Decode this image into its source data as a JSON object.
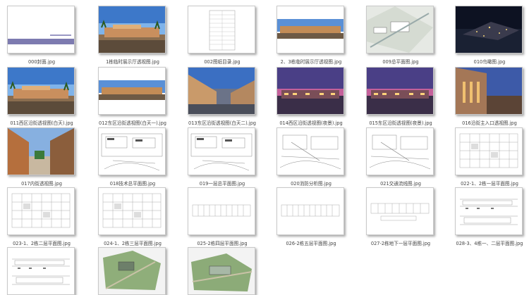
{
  "files": [
    {
      "name": "000封面.jpg",
      "kind": "cover"
    },
    {
      "name": "1栋临时展示厅透视图.jpg",
      "kind": "day"
    },
    {
      "name": "002图纸目录.jpg",
      "kind": "list"
    },
    {
      "name": "2、3栋临时展示厅透视图.jpg",
      "kind": "day2"
    },
    {
      "name": "009总平面图.jpg",
      "kind": "site"
    },
    {
      "name": "010鸟瞰图.jpg",
      "kind": "aerial"
    },
    {
      "name": "011西区沿街透视图(白天).jpg",
      "kind": "day"
    },
    {
      "name": "012东区沿街透视图(白天一).jpg",
      "kind": "day2"
    },
    {
      "name": "013东区沿街透视图(白天二).jpg",
      "kind": "street"
    },
    {
      "name": "014西区沿街透视图(夜景).jpg",
      "kind": "dusk"
    },
    {
      "name": "015东区沿街透视图(夜景).jpg",
      "kind": "dusk"
    },
    {
      "name": "016沿街主入口透视图.jpg",
      "kind": "tower"
    },
    {
      "name": "017内街透视图.jpg",
      "kind": "inner"
    },
    {
      "name": "018技术总平面图.jpg",
      "kind": "plan"
    },
    {
      "name": "019一层总平面图.jpg",
      "kind": "plan"
    },
    {
      "name": "020消防分析图.jpg",
      "kind": "plan2"
    },
    {
      "name": "021交通流线图.jpg",
      "kind": "plan2"
    },
    {
      "name": "022-1、2栋一层平面图.jpg",
      "kind": "floor"
    },
    {
      "name": "023-1、2栋二层平面图.jpg",
      "kind": "floor"
    },
    {
      "name": "024-1、2栋三层平面图.jpg",
      "kind": "floor"
    },
    {
      "name": "025-2栋四层平面图.jpg",
      "kind": "long"
    },
    {
      "name": "026-2栋五层平面图.jpg",
      "kind": "long"
    },
    {
      "name": "027-2栋地下一层平面图.jpg",
      "kind": "long2"
    },
    {
      "name": "028-3、4栋一、二层平面图.jpg",
      "kind": "elev"
    },
    {
      "name": "",
      "kind": "elev"
    },
    {
      "name": "",
      "kind": "green"
    },
    {
      "name": "",
      "kind": "green2"
    }
  ]
}
